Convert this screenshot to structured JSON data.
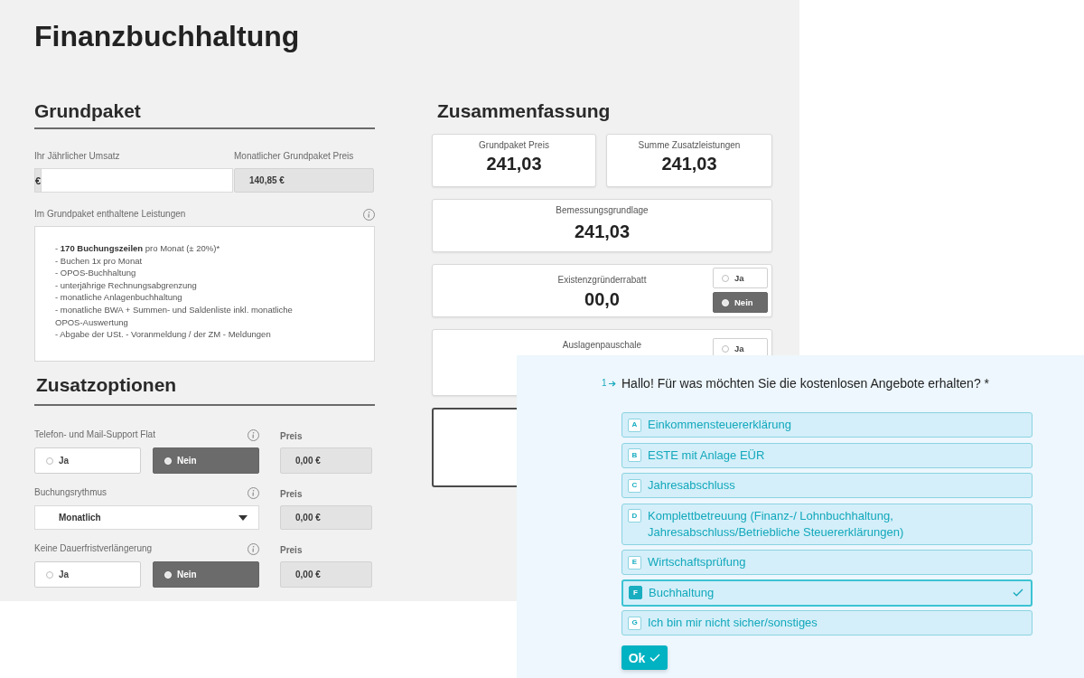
{
  "page": {
    "title": "Finanzbuchhaltung"
  },
  "grundpaket": {
    "heading": "Grundpaket",
    "revenue": {
      "label": "Ihr Jährlicher Umsatz",
      "prefix": "€"
    },
    "monthly_price": {
      "label": "Monatlicher Grundpaket Preis",
      "value": "140,85 €"
    },
    "services": {
      "label": "Im Grundpaket enthaltene Leistungen",
      "lines": [
        "- **170 Buchungszeilen** pro Monat (± 20%)*",
        "- Buchen 1x pro Monat",
        "- OPOS-Buchhaltung",
        "- unterjährige Rechnungsabgrenzung",
        "- monatliche Anlagenbuchhaltung",
        "- monatliche BWA + Summen- und Saldenliste inkl. monatliche OPOS-Auswertung",
        "- Abgabe der USt. - Voranmeldung / der ZM - Meldungen"
      ]
    }
  },
  "zusatzoptionen": {
    "heading": "Zusatzoptionen",
    "options": [
      {
        "kind": "toggle",
        "label": "Telefon- und Mail-Support Flat",
        "choices": [
          {
            "label": "Ja",
            "selected": false
          },
          {
            "label": "Nein",
            "selected": true
          }
        ],
        "price_label": "Preis",
        "price": "0,00 €"
      },
      {
        "kind": "select",
        "label": "Buchungsrythmus",
        "value": "Monatlich",
        "price_label": "Preis",
        "price": "0,00 €"
      },
      {
        "kind": "toggle",
        "label": "Keine Dauerfristverlängerung",
        "choices": [
          {
            "label": "Ja",
            "selected": false
          },
          {
            "label": "Nein",
            "selected": true
          }
        ],
        "price_label": "Preis",
        "price": "0,00 €"
      }
    ]
  },
  "zusammenfassung": {
    "heading": "Zusammenfassung",
    "cards": [
      {
        "kind": "half",
        "label": "Grundpaket Preis",
        "value": "241,03"
      },
      {
        "kind": "half",
        "label": "Summe Zusatzleistungen",
        "value": "241,03"
      },
      {
        "kind": "full",
        "label": "Bemessungsgrundlage",
        "value": "241,03"
      },
      {
        "kind": "toggle",
        "label": "Existenzgründerrabatt",
        "value": "00,0",
        "choices": [
          {
            "label": "Ja",
            "selected": false
          },
          {
            "label": "Nein",
            "selected": true
          }
        ]
      },
      {
        "kind": "toggle",
        "label": "Auslagenpauschale",
        "choices": [
          {
            "label": "Ja",
            "selected": false
          }
        ]
      },
      {
        "kind": "total"
      }
    ]
  },
  "quiz": {
    "question": {
      "number": "1",
      "text": "Hallo! Für was möchten Sie die kostenlosen Angebote erhalten? *"
    },
    "options": [
      {
        "key": "A",
        "label": "Einkommensteuererklärung",
        "selected": false
      },
      {
        "key": "B",
        "label": "ESTE mit Anlage EÜR",
        "selected": false
      },
      {
        "key": "C",
        "label": "Jahresabschluss",
        "selected": false
      },
      {
        "key": "D",
        "label": "Komplettbetreuung (Finanz-/ Lohnbuchhaltung, Jahresabschluss/Betriebliche Steuererklärungen)",
        "selected": false
      },
      {
        "key": "E",
        "label": "Wirtschaftsprüfung",
        "selected": false
      },
      {
        "key": "F",
        "label": "Buchhaltung",
        "selected": true
      },
      {
        "key": "G",
        "label": "Ich bin mir nicht sicher/sonstiges",
        "selected": false
      }
    ],
    "submit": {
      "label": "Ok"
    }
  }
}
